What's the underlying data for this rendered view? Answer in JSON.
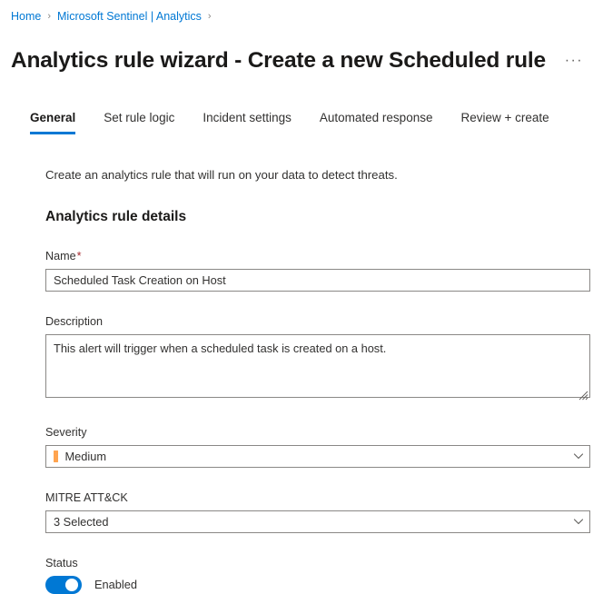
{
  "breadcrumb": {
    "items": [
      {
        "label": "Home"
      },
      {
        "label": "Microsoft Sentinel | Analytics"
      }
    ],
    "separator": "›"
  },
  "header": {
    "title": "Analytics rule wizard - Create a new Scheduled rule",
    "more_label": "···"
  },
  "tabs": [
    {
      "label": "General",
      "active": true
    },
    {
      "label": "Set rule logic",
      "active": false
    },
    {
      "label": "Incident settings",
      "active": false
    },
    {
      "label": "Automated response",
      "active": false
    },
    {
      "label": "Review + create",
      "active": false
    }
  ],
  "main": {
    "intro": "Create an analytics rule that will run on your data to detect threats.",
    "section_heading": "Analytics rule details",
    "fields": {
      "name": {
        "label": "Name",
        "required_marker": "*",
        "value": "Scheduled Task Creation on Host",
        "placeholder": ""
      },
      "description": {
        "label": "Description",
        "value": "This alert will trigger when a scheduled task is created on a host.",
        "placeholder": ""
      },
      "severity": {
        "label": "Severity",
        "value": "Medium",
        "swatch_color": "#ffa44f"
      },
      "mitre": {
        "label": "MITRE ATT&CK",
        "value": "3 Selected"
      },
      "status": {
        "label": "Status",
        "toggle_label": "Enabled",
        "enabled": true,
        "accent_color": "#0078d4"
      }
    }
  }
}
